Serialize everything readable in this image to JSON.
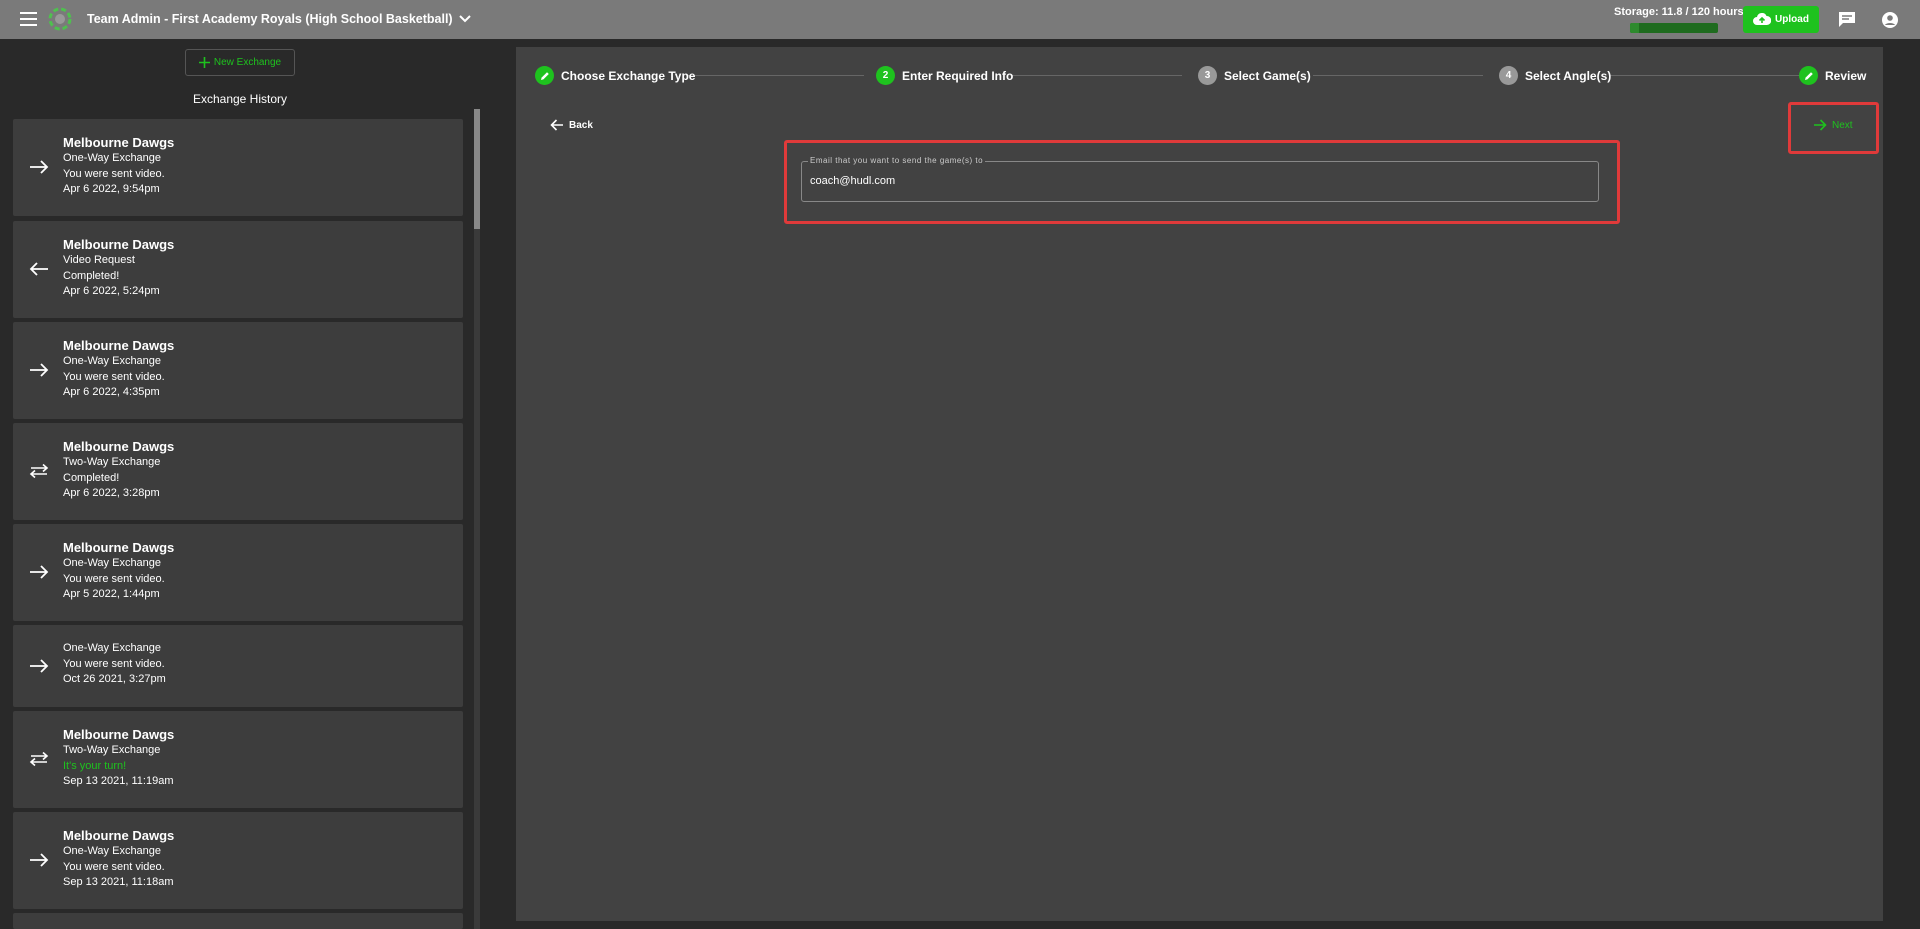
{
  "header": {
    "team_title": "Team Admin - First Academy Royals (High School Basketball)",
    "storage_label": "Storage: 11.8 / 120 hours",
    "storage_fraction": 0.098,
    "upload_label": "Upload"
  },
  "sidebar": {
    "new_exchange_label": "New Exchange",
    "history_title": "Exchange History",
    "items": [
      {
        "team": "Melbourne Dawgs",
        "type": "One-Way Exchange",
        "status": "You were sent video.",
        "status_green": false,
        "date": "Apr 6 2022, 9:54pm",
        "direction": "right"
      },
      {
        "team": "Melbourne Dawgs",
        "type": "Video Request",
        "status": "Completed!",
        "status_green": false,
        "date": "Apr 6 2022, 5:24pm",
        "direction": "left"
      },
      {
        "team": "Melbourne Dawgs",
        "type": "One-Way Exchange",
        "status": "You were sent video.",
        "status_green": false,
        "date": "Apr 6 2022, 4:35pm",
        "direction": "right"
      },
      {
        "team": "Melbourne Dawgs",
        "type": "Two-Way Exchange",
        "status": "Completed!",
        "status_green": false,
        "date": "Apr 6 2022, 3:28pm",
        "direction": "both"
      },
      {
        "team": "Melbourne Dawgs",
        "type": "One-Way Exchange",
        "status": "You were sent video.",
        "status_green": false,
        "date": "Apr 5 2022, 1:44pm",
        "direction": "right"
      },
      {
        "team": "",
        "type": "One-Way Exchange",
        "status": "You were sent video.",
        "status_green": false,
        "date": "Oct 26 2021, 3:27pm",
        "direction": "right"
      },
      {
        "team": "Melbourne Dawgs",
        "type": "Two-Way Exchange",
        "status": "It's your turn!",
        "status_green": true,
        "date": "Sep 13 2021, 11:19am",
        "direction": "both"
      },
      {
        "team": "Melbourne Dawgs",
        "type": "One-Way Exchange",
        "status": "You were sent video.",
        "status_green": false,
        "date": "Sep 13 2021, 11:18am",
        "direction": "right"
      }
    ]
  },
  "stepper": {
    "steps": [
      {
        "label": "Choose Exchange Type",
        "marker": "",
        "state": "done"
      },
      {
        "label": "Enter Required Info",
        "marker": "2",
        "state": "active"
      },
      {
        "label": "Select Game(s)",
        "marker": "3",
        "state": "pending"
      },
      {
        "label": "Select Angle(s)",
        "marker": "4",
        "state": "pending"
      },
      {
        "label": "Review",
        "marker": "",
        "state": "done"
      }
    ]
  },
  "nav": {
    "back_label": "Back",
    "next_label": "Next"
  },
  "form": {
    "email_label": "Email that you want to send the game(s) to",
    "email_value": "coach@hudl.com"
  },
  "colors": {
    "accent": "#1ec21e",
    "highlight": "#e03a3a",
    "topbar": "#7a7a7a",
    "panel": "#424242",
    "card": "#3d3d3d"
  }
}
